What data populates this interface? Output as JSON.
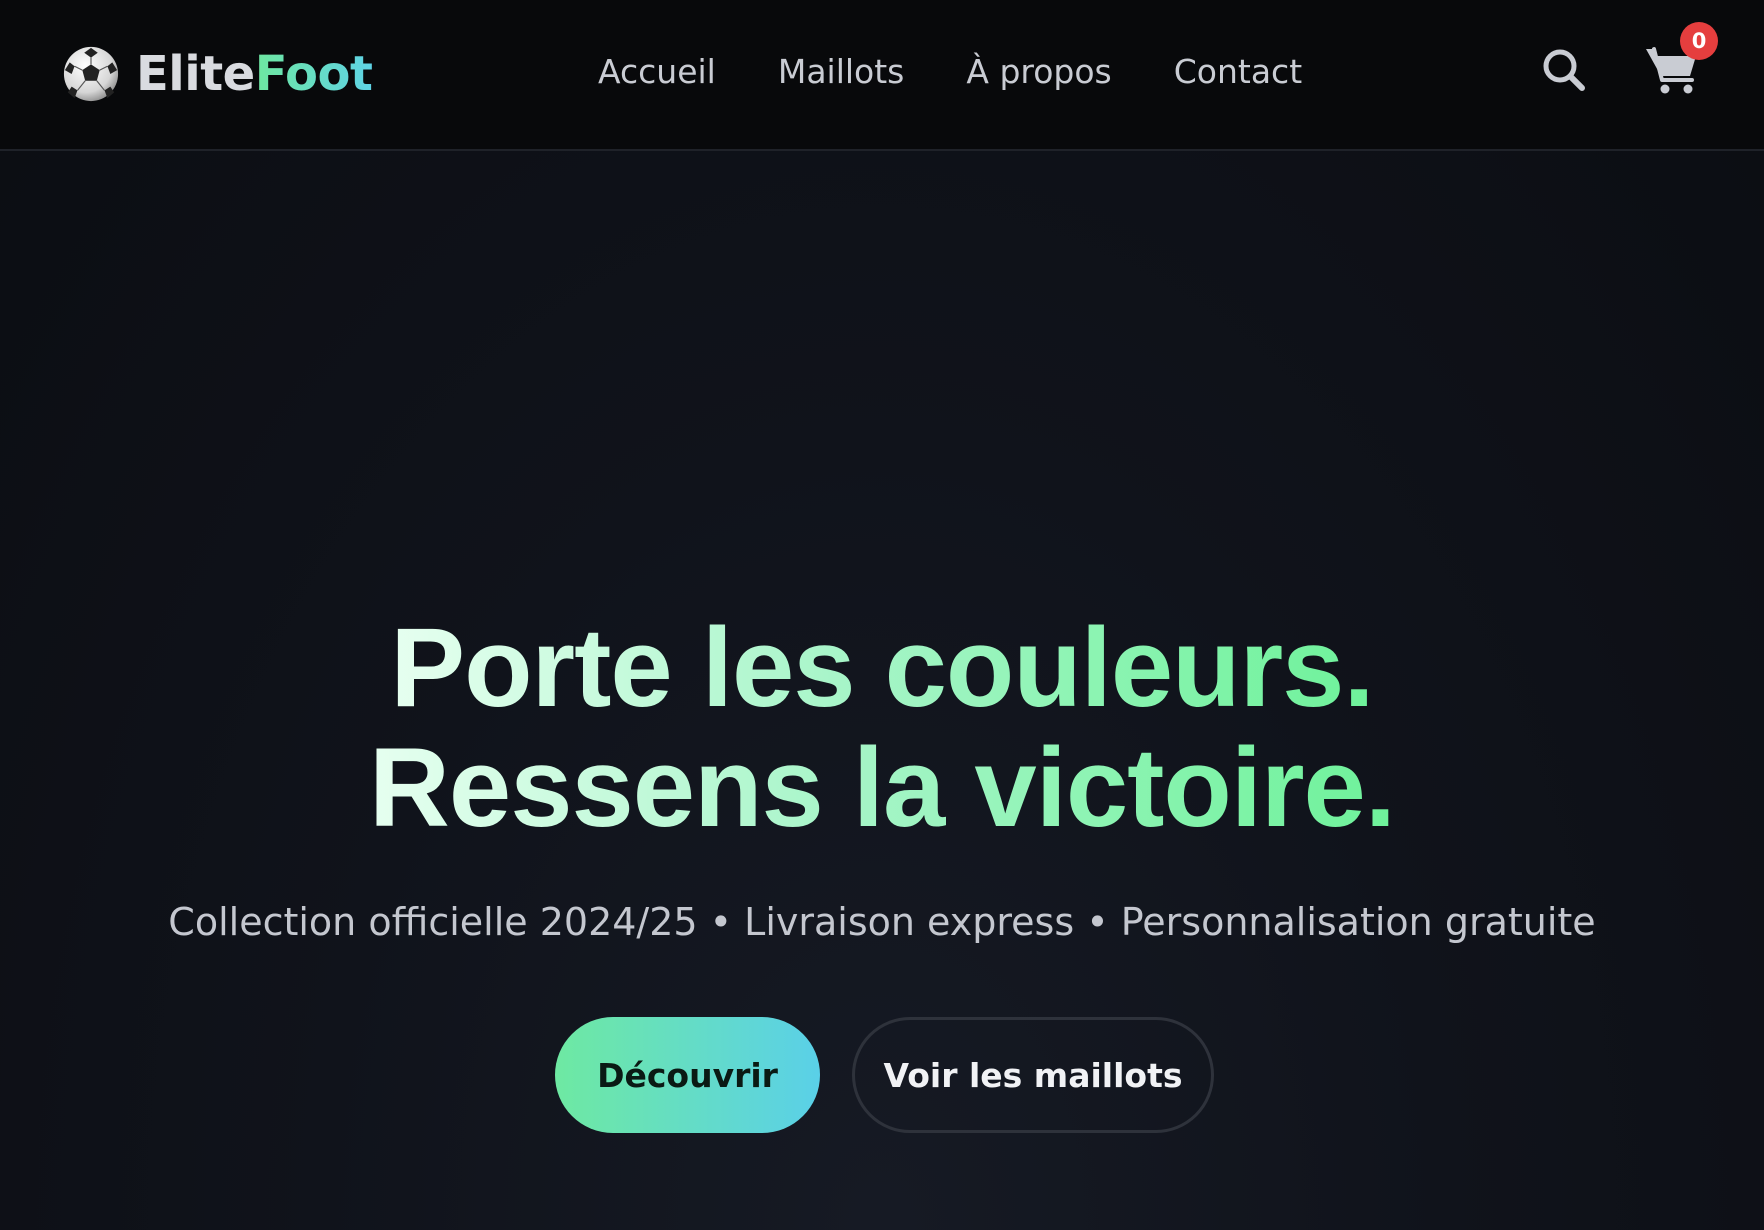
{
  "brand": {
    "name_part1": "Elite",
    "name_part2": "Foot",
    "logo_icon": "soccer-ball-icon",
    "accent_gradient": [
      "#6ee7a0",
      "#5fd3e6"
    ]
  },
  "nav": {
    "items": [
      {
        "label": "Accueil"
      },
      {
        "label": "Maillots"
      },
      {
        "label": "À propos"
      },
      {
        "label": "Contact"
      }
    ]
  },
  "header_actions": {
    "search_icon": "search-icon",
    "cart_icon": "cart-icon",
    "cart_count": "0",
    "badge_color": "#e53e3e"
  },
  "hero": {
    "title_line1": "Porte les couleurs.",
    "title_line2": "Ressens la victoire.",
    "subtitle": "Collection officielle 2024/25 • Livraison express • Personnalisation gratuite",
    "primary_button": "Découvrir",
    "secondary_button": "Voir les maillots",
    "title_gradient": [
      "#e6fff0",
      "#6ef29a"
    ]
  }
}
